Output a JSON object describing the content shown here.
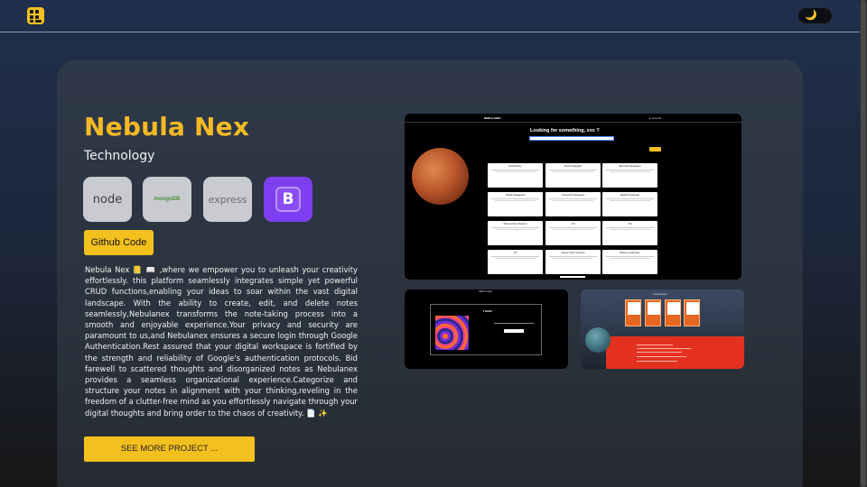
{
  "topbar": {
    "logo_icon": "grid-dots-logo-icon",
    "theme_toggle_icon": "moon-icon",
    "theme_toggle_glyph": "🌙"
  },
  "project": {
    "title": "Nebula Nex",
    "category": "Technology",
    "technologies": [
      {
        "name": "node",
        "label": "node"
      },
      {
        "name": "mongodb",
        "label": "mongoDB"
      },
      {
        "name": "express",
        "label": "express"
      },
      {
        "name": "bootstrap",
        "label": "B"
      }
    ],
    "github_label": "Github Code",
    "description": "Nebula Nex 📒 📖 ,where we empower you to unleash your creativity effortlessly. this platform seamlessly integrates simple yet powerful CRUD functions,enabling your ideas to soar within the vast digital landscape. With the ability to create, edit, and delete notes seamlessly,Nebulanex transforms the note-taking process into a smooth and enjoyable experience.Your privacy and security are paramount to us,and Nebulanex ensures a secure login through Google Authentication.Rest assured that your digital workspace is fortified by the strength and reliability of Google's authentication protocols. Bid farewell to scattered thoughts and disorganized notes as Nebulanex provides a seamless organizational experience.Categorize and structure your notes in alignment with your thinking,reveling in the freedom of a clutter-free mind as you effortlessly navigate through your digital thoughts and bring order to the chaos of creativity. 📄 ✨",
    "see_more_label": "SEE MORE PROJECT ..."
  },
  "screenshots": {
    "main": {
      "brand": "NEBULANEX",
      "account": "▲ account",
      "search_title": "Looking for something, xxx ?",
      "cards": [
        "Ritual Party",
        "Sixth Paragraph",
        "Eleventh Paragraph",
        "Twelfth Paragraph",
        "Thirteenth Paragraph",
        "Eighth Paragraph",
        "Dinner Party Channel",
        "CN",
        "DS",
        "CN",
        "Dinner Party Channel",
        "Build a Local Fleet"
      ]
    },
    "login": {
      "brand": "NEBULANEX",
      "box_title": "LOGIN"
    },
    "advantages": {
      "title": "Advantages"
    }
  }
}
